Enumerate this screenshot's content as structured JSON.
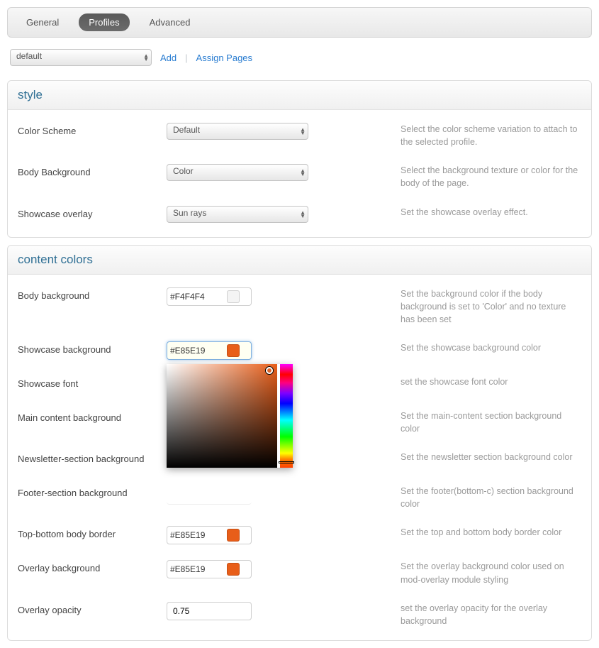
{
  "tabs": {
    "general": "General",
    "profiles": "Profiles",
    "advanced": "Advanced"
  },
  "toolbar": {
    "profile_selected": "default",
    "add": "Add",
    "assign": "Assign Pages"
  },
  "style": {
    "title": "style",
    "color_scheme": {
      "label": "Color Scheme",
      "value": "Default",
      "desc": "Select the color scheme variation to attach to the selected profile."
    },
    "body_background": {
      "label": "Body Background",
      "value": "Color",
      "desc": "Select the background texture or color for the body of the page."
    },
    "showcase_overlay": {
      "label": "Showcase overlay",
      "value": "Sun rays",
      "desc": "Set the showcase overlay effect."
    }
  },
  "content_colors": {
    "title": "content colors",
    "body_bg": {
      "label": "Body background",
      "value": "#F4F4F4",
      "swatch": "#F4F4F4",
      "desc": "Set the background color if the body background is set to 'Color' and no texture has been set"
    },
    "showcase_bg": {
      "label": "Showcase background",
      "value": "#E85E19",
      "swatch": "#E85E19",
      "desc": "Set the showcase background color"
    },
    "showcase_font": {
      "label": "Showcase font",
      "desc": "set the showcase font color"
    },
    "main_content_bg": {
      "label": "Main content background",
      "desc": "Set the main-content section background color"
    },
    "newsletter_bg": {
      "label": "Newsletter-section background",
      "desc": "Set the newsletter section background color"
    },
    "footer_bg": {
      "label": "Footer-section background",
      "desc": "Set the footer(bottom-c) section background color"
    },
    "top_bottom_border": {
      "label": "Top-bottom body border",
      "value": "#E85E19",
      "swatch": "#E85E19",
      "desc": "Set the top and bottom body border color"
    },
    "overlay_bg": {
      "label": "Overlay background",
      "value": "#E85E19",
      "swatch": "#E85E19",
      "desc": "Set the overlay background color used on mod-overlay module styling"
    },
    "overlay_opacity": {
      "label": "Overlay opacity",
      "value": "0.75",
      "desc": "set the overlay opacity for the overlay background"
    }
  }
}
